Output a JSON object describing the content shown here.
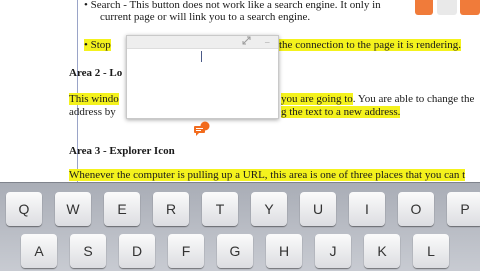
{
  "document": {
    "line1_search_label": "Search",
    "line1_rest": " - This button does not work like a search engine. It only in",
    "line2": "current page or will link you to a search engine.",
    "line3_left": "Stop",
    "line3_right": "the connection to the page it is rendering.",
    "heading_area2_left": "Area 2 - Lo",
    "para_line1_left": "This windo",
    "para_line1_mid": "you are going to",
    "para_line1_right": ". You are able to change the",
    "para_line2_left": "address by",
    "para_line2_right": "g the text to a new address.",
    "heading_area3": "Area 3 - Explorer Icon",
    "para3_line1": "Whenever the computer is pulling up a URL, this area is one of three places that you can t"
  },
  "note_popup": {
    "expand_icon": "expand-icon",
    "minimize_icon": "minimize-icon",
    "minimize_glyph": "–",
    "text": ""
  },
  "note_anchor": {
    "icon": "comment-icon",
    "color": "#f26b1d"
  },
  "keyboard": {
    "row1": [
      "Q",
      "W",
      "E",
      "R",
      "T",
      "Y",
      "U",
      "I",
      "O",
      "P"
    ],
    "row2": [
      "A",
      "S",
      "D",
      "F",
      "G",
      "H",
      "J",
      "K",
      "L"
    ]
  },
  "colors": {
    "highlight": "#f4f21d",
    "accent": "#f26b1d"
  }
}
